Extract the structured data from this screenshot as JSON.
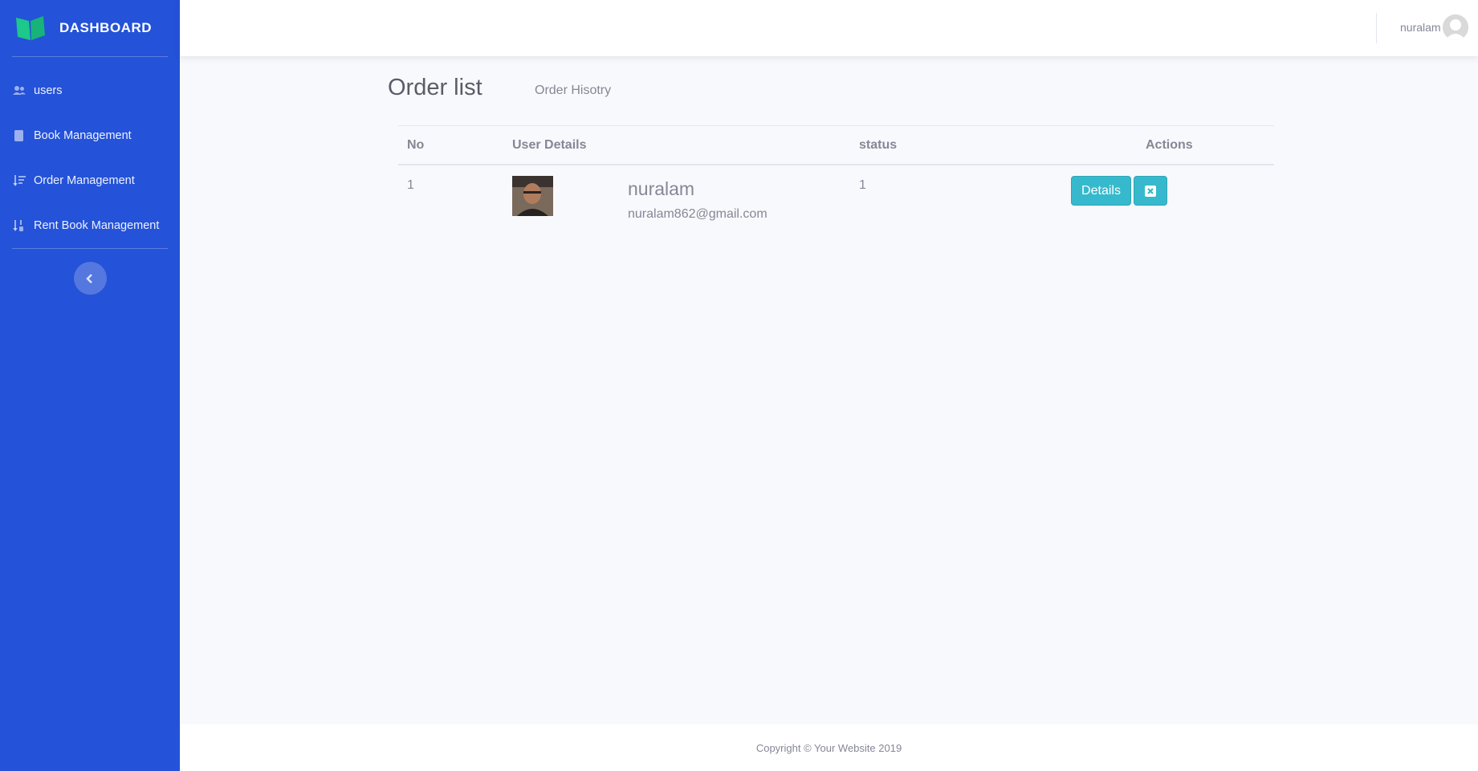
{
  "sidebar": {
    "brand": "DASHBOARD",
    "items": [
      {
        "label": "users",
        "icon": "users-icon"
      },
      {
        "label": "Book Management",
        "icon": "book-icon"
      },
      {
        "label": "Order Management",
        "icon": "sort-amount-icon"
      },
      {
        "label": "Rent Book Management",
        "icon": "sort-numeric-icon"
      }
    ],
    "toggle_icon": "chevron-left-icon"
  },
  "topbar": {
    "user_name": "nuralam",
    "avatar_icon": "user-avatar-icon"
  },
  "main": {
    "title": "Order list",
    "subtitle": "Order Hisotry",
    "table": {
      "headers": [
        "No",
        "User Details",
        "status",
        "Actions"
      ],
      "rows": [
        {
          "no": "1",
          "name": "nuralam",
          "email": "nuralam862@gmail.com",
          "status": "1",
          "details_label": "Details",
          "delete_icon": "close-box-icon"
        }
      ]
    }
  },
  "footer": {
    "copyright": "Copyright © Your Website 2019"
  },
  "colors": {
    "sidebar": "#2452d8",
    "accent": "#36b9cc",
    "brand_icon": "#1cc88a"
  }
}
